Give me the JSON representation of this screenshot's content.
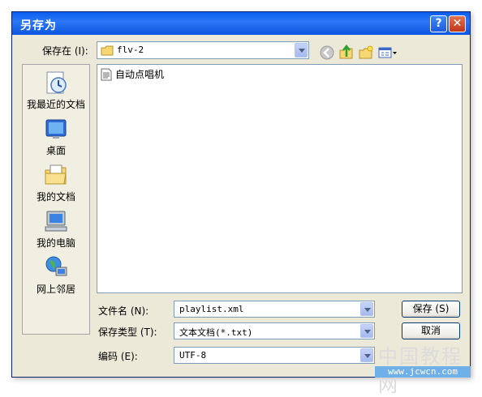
{
  "window": {
    "title": "另存为",
    "help_label": "?",
    "close_label": "✕"
  },
  "toolbar": {
    "save_in_label": "保存在 (I):",
    "save_in_value": "flv-2",
    "icons": [
      "back-icon",
      "up-folder-icon",
      "new-folder-icon",
      "views-menu-icon"
    ]
  },
  "places": [
    {
      "label": "我最近的文档",
      "icon": "recent-documents-icon"
    },
    {
      "label": "桌面",
      "icon": "desktop-icon"
    },
    {
      "label": "我的文档",
      "icon": "my-documents-icon"
    },
    {
      "label": "我的电脑",
      "icon": "my-computer-icon"
    },
    {
      "label": "网上邻居",
      "icon": "network-places-icon"
    }
  ],
  "files": [
    {
      "name": "自动点唱机",
      "icon": "text-file-icon"
    }
  ],
  "form": {
    "filename_label": "文件名 (N):",
    "filename_value": "playlist.xml",
    "filetype_label": "保存类型 (T):",
    "filetype_value": "文本文档(*.txt)",
    "encoding_label": "编码 (E):",
    "encoding_value": "UTF-8"
  },
  "buttons": {
    "save": "保存 (S)",
    "cancel": "取消"
  },
  "watermark": {
    "text": "中国教程网",
    "url": "www.jcwcn.com"
  }
}
